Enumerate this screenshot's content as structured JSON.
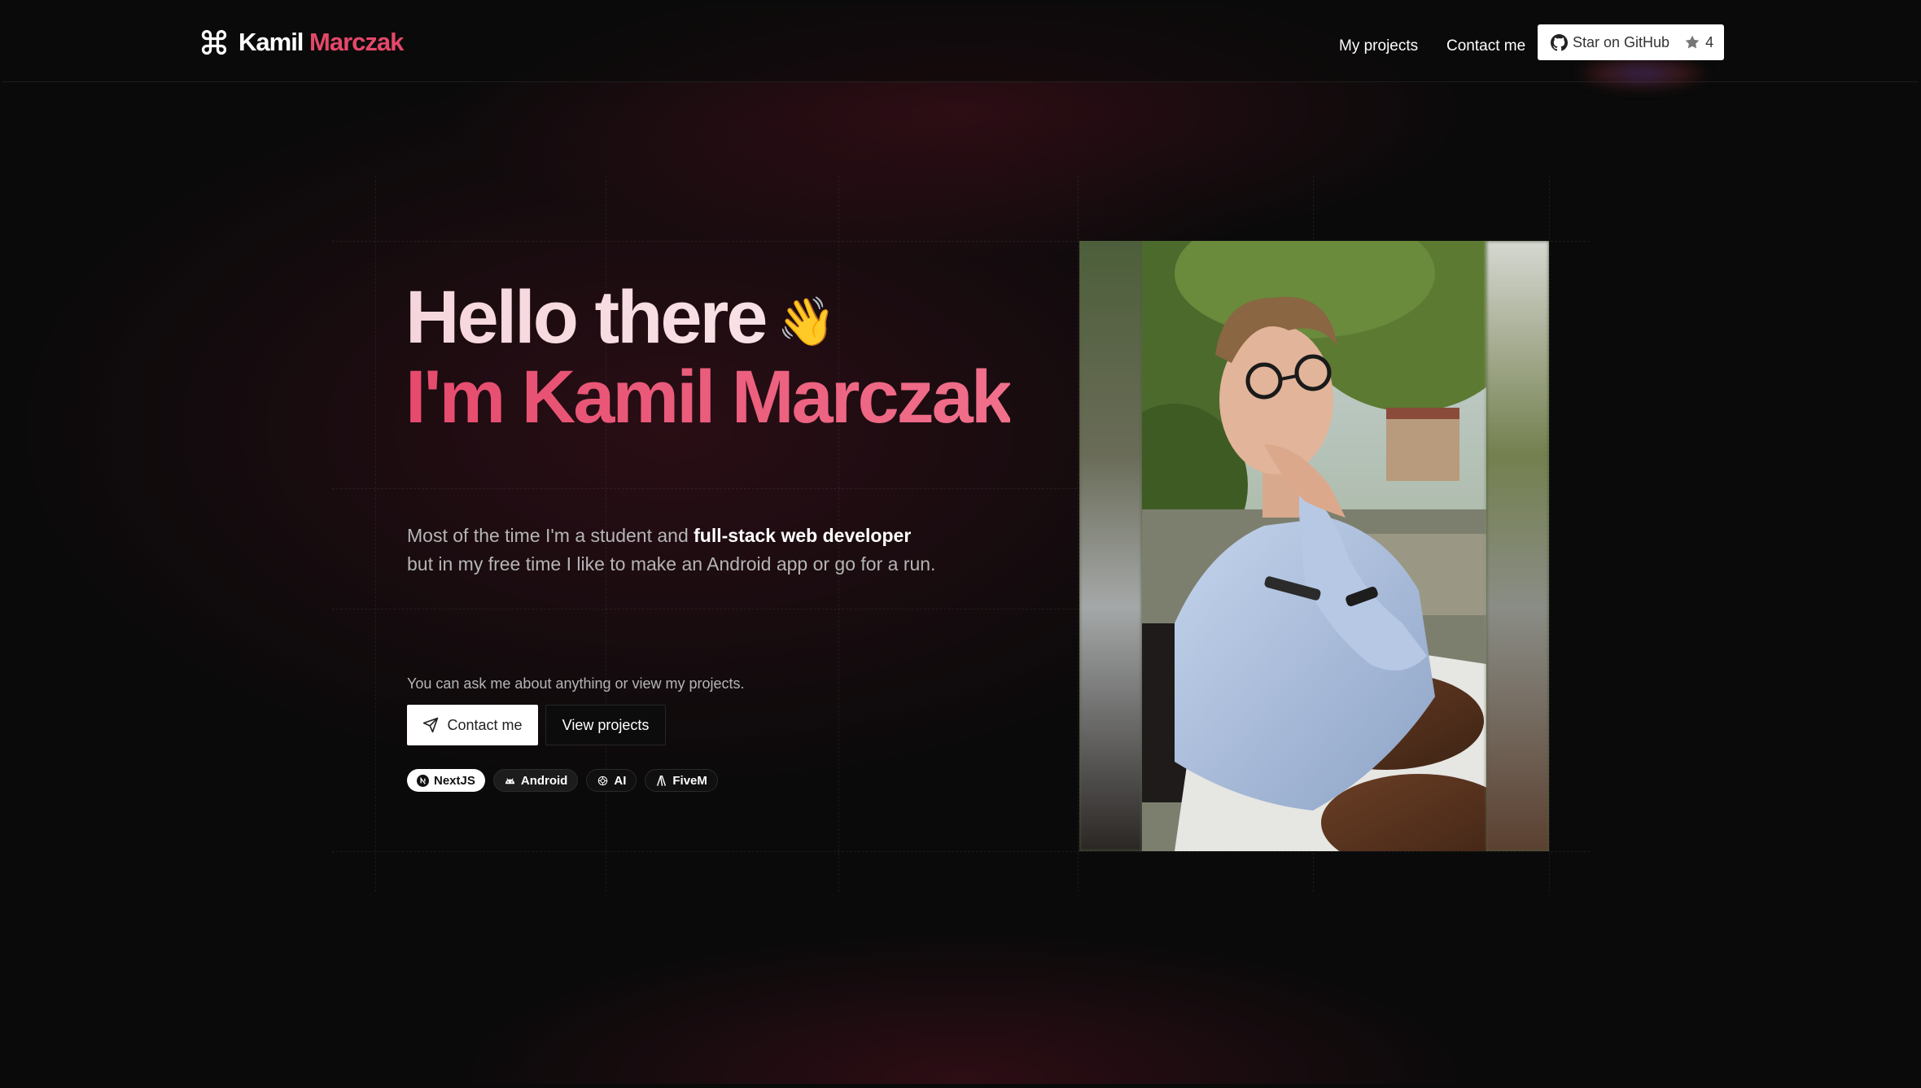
{
  "nav": {
    "brand_first": "Kamil",
    "brand_last": "Marczak",
    "links": [
      {
        "label": "My projects"
      },
      {
        "label": "Contact me"
      }
    ],
    "github": {
      "label": "Star on GitHub",
      "stars": "4"
    }
  },
  "hero": {
    "line1": "Hello there",
    "wave_emoji": "👋",
    "line2": "I'm Kamil Marczak",
    "description": {
      "part1": "Most of the time I'm a student and ",
      "bold": "full-stack web developer",
      "part2": "but in my free time I like to make an Android app or go for a run."
    },
    "ask_text": "You can ask me about anything or view my projects.",
    "contact_button": "Contact me",
    "projects_button": "View projects",
    "badges": [
      {
        "label": "NextJS",
        "icon": "nextjs-icon"
      },
      {
        "label": "Android",
        "icon": "android-icon"
      },
      {
        "label": "AI",
        "icon": "openai-icon"
      },
      {
        "label": "FiveM",
        "icon": "fivem-icon"
      }
    ]
  },
  "colors": {
    "accent": "#e5486a",
    "background": "#0a0a0a"
  }
}
